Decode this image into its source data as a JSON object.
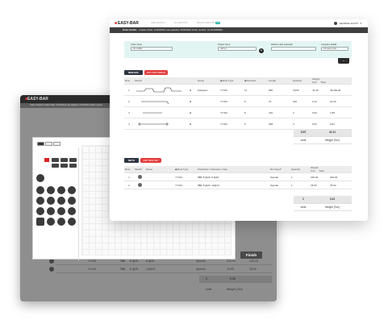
{
  "app": {
    "logo": "EASY-BAR",
    "logo_mark": "■"
  },
  "front": {
    "nav": [
      "AREA DETAILS",
      "ALL REPORTS",
      "RESULTS REPORT"
    ],
    "nav_badge": "new",
    "user": "GEORGE SCOTT",
    "info": {
      "label": "Order Details",
      "text": "Creation Date: 21/10/2021 Last updated: 21/10/2021 Order number: 01.04.0000000"
    },
    "form": {
      "order_name": {
        "label": "Order name",
        "value": "Ido nadlan"
      },
      "project_name": {
        "label": "Project name",
        "value": "name 1"
      },
      "delivery_date": {
        "label": "Delivery date (optional)",
        "value": ""
      },
      "company": {
        "label": "Company details",
        "value": "Company plan"
      }
    },
    "collapse_icon": "chevron-down-icon",
    "rebars": {
      "title": "REBARS",
      "add_label": "ADD NEW REBAR",
      "headers": [
        "Row",
        "Sketch",
        "",
        "Name",
        "Steel Type",
        "Diameter",
        "Length",
        "Quantity",
        "Weight"
      ],
      "weight_sub": [
        "Unit",
        "Total"
      ],
      "rows": [
        {
          "row": "1",
          "name": "Kitasaam",
          "steel": "Y/Y/#1",
          "diameter": "14",
          "length": "695",
          "quantity": "3,000",
          "unit": "41.30",
          "total": "49,000.00"
        },
        {
          "row": "2",
          "name": "",
          "steel": "Y/Y/#1",
          "diameter": "5",
          "length": "73",
          "quantity": "100",
          "unit": "0.12",
          "total": "12.00"
        },
        {
          "row": "3",
          "name": "",
          "steel": "Y/Y/#1",
          "diameter": "5",
          "length": "410",
          "quantity": "3",
          "unit": "0.63",
          "total": "1.85"
        },
        {
          "row": "4",
          "name": "",
          "steel": "Y/Y/#1",
          "diameter": "5",
          "length": "358",
          "quantity": "4",
          "unit": "0.51",
          "total": "0.64"
        }
      ],
      "totals": {
        "quantity": "1107",
        "weight": "41.31",
        "quantity_label": "units",
        "weight_label": "Weight (Ton)"
      }
    },
    "nets": {
      "title": "NETS",
      "add_label": "ADD NEW NET",
      "headers": [
        "Row",
        "Sketch",
        "Name",
        "Steel Type",
        "Total Diam / Diameter / Gap",
        "",
        "Net Type",
        "Quantity",
        "Weight"
      ],
      "weight_sub": [
        "Unit",
        "Total"
      ],
      "rows": [
        {
          "row": "1",
          "steel": "Y/Y/#1",
          "spec": "700",
          "d1": "8 @20",
          "d2": "8 @20",
          "type": "Special",
          "quantity": "1",
          "unit": "229.03",
          "total": "229.03"
        },
        {
          "row": "2",
          "steel": "Y/Y/#1",
          "spec": "700",
          "d1": "8 @20",
          "d2": "12@13",
          "type": "Special",
          "quantity": "1",
          "unit": "78.93",
          "total": "78.93"
        }
      ],
      "totals": {
        "quantity": "2",
        "weight": "0.32",
        "quantity_label": "units",
        "weight_label": "Weight (Ton)"
      }
    }
  },
  "back": {
    "info": "Order Details  Creation Date: 21/10/2021  Last updated: 21/10/2021  Order number",
    "modal": {
      "tabs": [
        "2D",
        "3D",
        "Lib"
      ],
      "section_label": "SELECTED",
      "canvas_label": "Drawing",
      "button_labels": [
        "",
        "",
        "",
        "",
        "",
        ""
      ],
      "finish_label": "Finish"
    },
    "rows": [
      {
        "steel": "Y/Y/#1",
        "spec": "700",
        "d1": "8 @20",
        "d2": "8 @20",
        "type": "Special",
        "unit": "229.03",
        "total": "229.03"
      },
      {
        "steel": "Y/Y/#1",
        "spec": "700",
        "d1": "8 @20",
        "d2": "12@13",
        "type": "Special",
        "unit": "78.93",
        "total": "78.93"
      }
    ],
    "totals": {
      "quantity": "2",
      "weight": "0.32",
      "quantity_label": "units",
      "weight_label": "Weight (Ton)"
    }
  }
}
